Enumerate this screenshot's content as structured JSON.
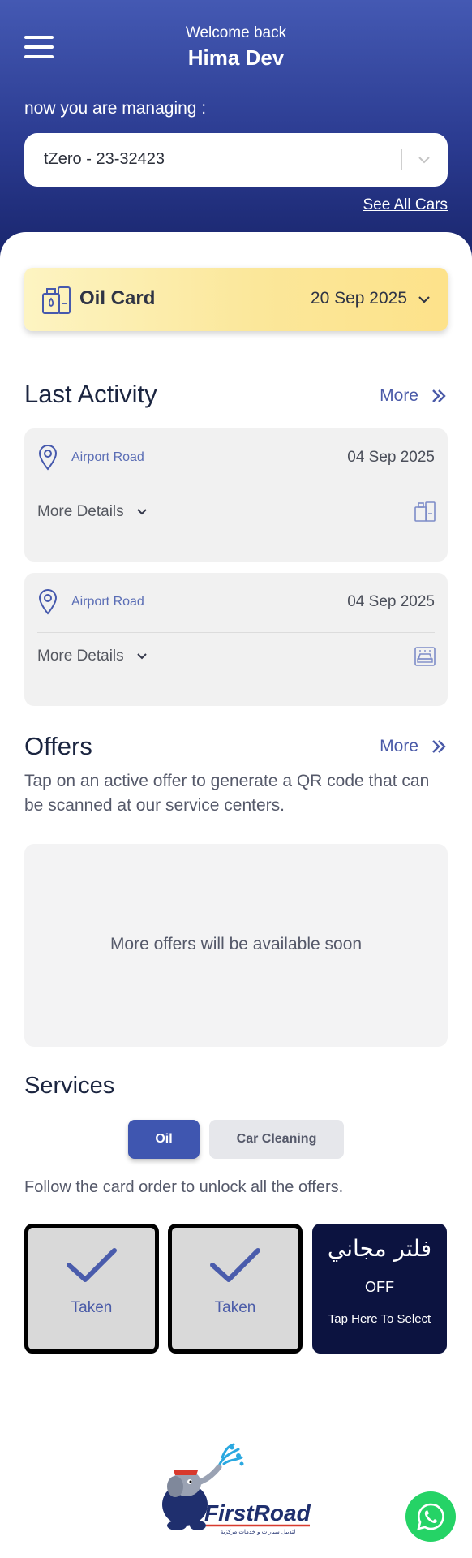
{
  "header": {
    "welcome": "Welcome back",
    "username": "Hima Dev",
    "managing_label": "now you are managing :",
    "selected_car": "tZero - 23-32423",
    "see_all_cars": "See All Cars",
    "icons": [
      "menu-icon",
      "chevron-down-icon"
    ]
  },
  "oil_card": {
    "title": "Oil Card",
    "date": "20 Sep 2025",
    "icon": "oil-can-icon"
  },
  "last_activity": {
    "title": "Last Activity",
    "more": "More",
    "items": [
      {
        "location": "Airport Road",
        "date": "04 Sep 2025",
        "details_label": "More Details",
        "service_icon": "oil-service-icon"
      },
      {
        "location": "Airport Road",
        "date": "04 Sep 2025",
        "details_label": "More Details",
        "service_icon": "car-wash-icon"
      }
    ]
  },
  "offers": {
    "title": "Offers",
    "more": "More",
    "description": "Tap on an active offer to generate a QR code that can be scanned at our service centers.",
    "empty_message": "More offers will be available soon"
  },
  "services": {
    "title": "Services",
    "tabs": [
      {
        "label": "Oil",
        "active": true
      },
      {
        "label": "Car Cleaning",
        "active": false
      }
    ],
    "instruction": "Follow the card order to unlock all the offers.",
    "cards": [
      {
        "status": "Taken"
      },
      {
        "status": "Taken"
      },
      {
        "arabic": "فلتر مجاني",
        "off_label": "OFF",
        "action": "Tap Here To Select"
      }
    ]
  },
  "footer": {
    "logo_text": "FirstRoad",
    "logo_subtext": "لتدبيل سيارات و خدمات مركزية",
    "whatsapp_icon": "whatsapp-icon"
  },
  "colors": {
    "primary": "#3f56b0",
    "header_top": "#4459b3",
    "header_bottom": "#18246a",
    "oil_card": "#fbe79a",
    "offer_dark": "#0c1340",
    "whatsapp": "#25d366"
  }
}
